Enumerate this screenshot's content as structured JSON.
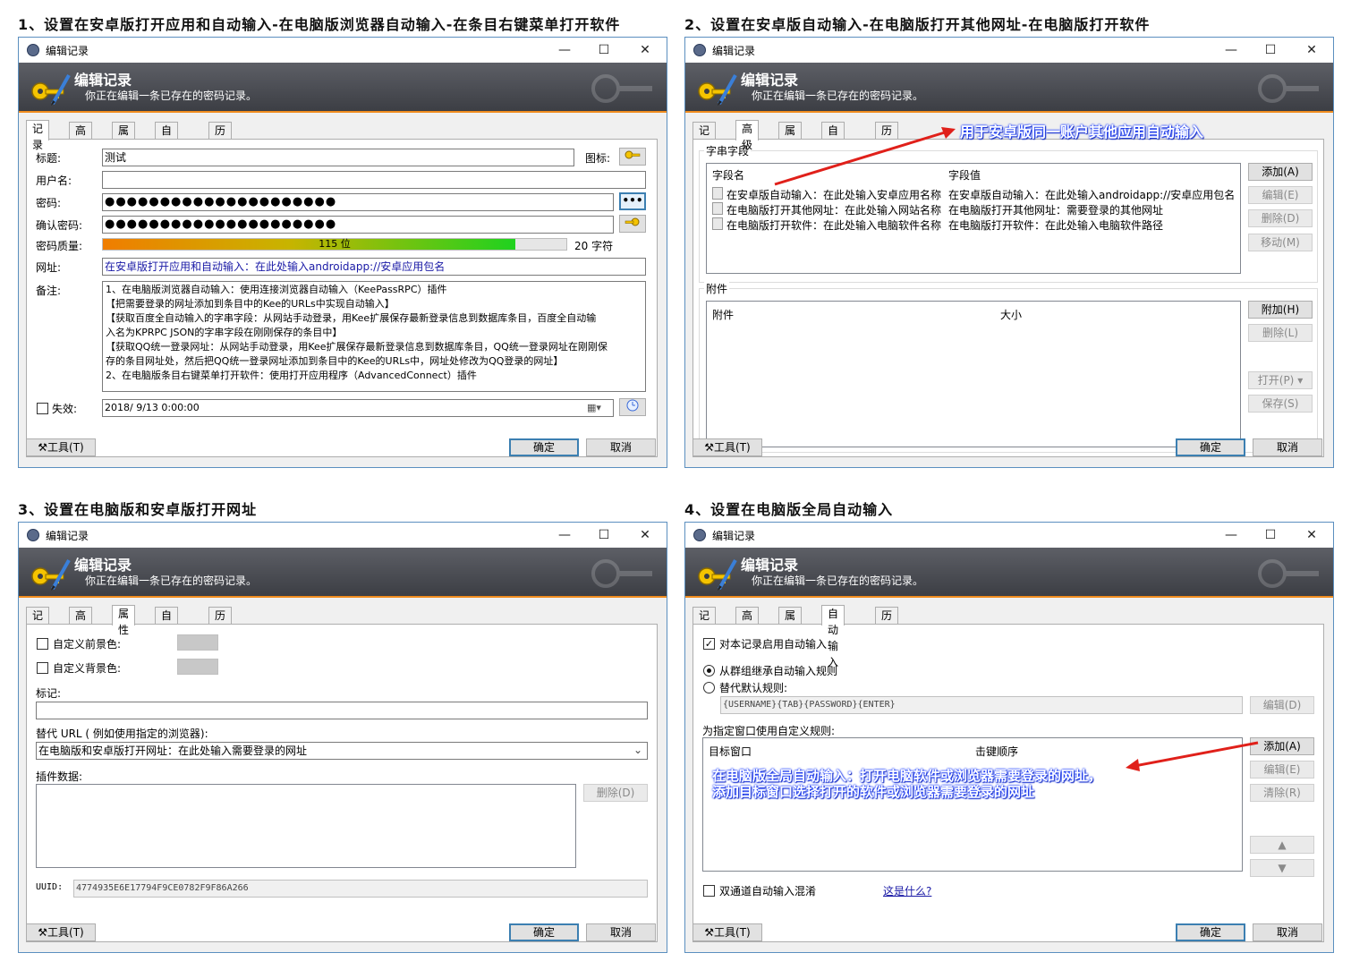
{
  "titles": {
    "s1": "1、设置在安卓版打开应用和自动输入-在电脑版浏览器自动输入-在条目右键菜单打开软件",
    "s2": "2、设置在安卓版自动输入-在电脑版打开其他网址-在电脑版打开软件",
    "s3": "3、设置在电脑版和安卓版打开网址",
    "s4": "4、设置在电脑版全局自动输入"
  },
  "window": {
    "title": "编辑记录",
    "banner_title": "编辑记录",
    "banner_sub": "你正在编辑一条已存在的密码记录。",
    "tabs": [
      "记录",
      "高级",
      "属性",
      "自动输入",
      "历史"
    ],
    "tools": "工具(T)",
    "ok": "确定",
    "cancel": "取消",
    "accent": "#f08c1e"
  },
  "w1": {
    "title_label": "标题:",
    "title_value": "测试",
    "icon_label": "图标:",
    "user_label": "用户名:",
    "user_value": "",
    "pwd_label": "密码:",
    "pwd_value": "●●●●●●●●●●●●●●●●●●●●●",
    "confirm_label": "确认密码:",
    "confirm_value": "●●●●●●●●●●●●●●●●●●●●●",
    "quality_label": "密码质量:",
    "quality_bits": "115 位",
    "quality_fraction": 0.89,
    "quality_chars": "20 字符",
    "url_label": "网址:",
    "url_value": "在安卓版打开应用和自动输入：在此处输入androidapp://安卓应用包名",
    "notes_label": "备注:",
    "notes": [
      "1、在电脑版浏览器自动输入：使用连接浏览器自动输入（KeePassRPC）插件",
      "【把需要登录的网址添加到条目中的Kee的URLs中实现自动输入】",
      "【获取百度全自动输入的字串字段：从网站手动登录，用Kee扩展保存最新登录信息到数据库条目，百度全自动输",
      "入名为KPRPC JSON的字串字段在刚刚保存的条目中】",
      "【获取QQ统一登录网址：从网站手动登录，用Kee扩展保存最新登录信息到数据库条目，QQ统一登录网址在刚刚保",
      "存的条目网址处，然后把QQ统一登录网址添加到条目中的Kee的URLs中，网址处修改为QQ登录的网址】",
      "2、在电脑版条目右键菜单打开软件：使用打开应用程序（AdvancedConnect）插件"
    ],
    "expires_label": "失效:",
    "expires_value": "2018/ 9/13  0:00:00"
  },
  "w2": {
    "strings_group": "字串字段",
    "col_name": "字段名",
    "col_value": "字段值",
    "rows": [
      {
        "name": "在安卓版自动输入：在此处输入安卓应用名称",
        "value": "在安卓版自动输入：在此处输入androidapp://安卓应用包名"
      },
      {
        "name": "在电脑版打开其他网址：在此处输入网站名称",
        "value": "在电脑版打开其他网址：需要登录的其他网址"
      },
      {
        "name": "在电脑版打开软件：在此处输入电脑软件名称",
        "value": "在电脑版打开软件：在此处输入电脑软件路径"
      }
    ],
    "add": "添加(A)",
    "edit": "编辑(E)",
    "delete": "删除(D)",
    "move": "移动(M)",
    "attach_group": "附件",
    "col_attach": "附件",
    "col_size": "大小",
    "attach": "附加(H)",
    "remove": "删除(L)",
    "open": "打开(P)",
    "save": "保存(S)",
    "annotation": "用于安卓版同一账户其他应用自动输入"
  },
  "w3": {
    "fg_label": "自定义前景色:",
    "bg_label": "自定义背景色:",
    "tags_label": "标记:",
    "tags_value": "",
    "override_label": "替代 URL ( 例如使用指定的浏览器):",
    "override_value": "在电脑版和安卓版打开网址：在此处输入需要登录的网址",
    "plugin_label": "插件数据:",
    "delete": "删除(D)",
    "uuid_label": "UUID:",
    "uuid_value": "4774935E6E17794F9CE0782F9F86A266"
  },
  "w4": {
    "enable": "对本记录启用自动输入",
    "inherit": "从群组继承自动输入规则",
    "override": "替代默认规则:",
    "sequence": "{USERNAME}{TAB}{PASSWORD}{ENTER}",
    "edit": "编辑(D)",
    "custom_label": "为指定窗口使用自定义规则:",
    "col_target": "目标窗口",
    "col_keys": "击键顺序",
    "add": "添加(A)",
    "edit2": "编辑(E)",
    "clear": "清除(R)",
    "up": "▲",
    "down": "▼",
    "obfuscate": "双通道自动输入混淆",
    "whats_this": "这是什么?",
    "annotation1": "在电脑版全局自动输入：打开电脑软件或浏览器需要登录的网址，",
    "annotation2": "添加目标窗口选择打开的软件或浏览器需要登录的网址"
  }
}
